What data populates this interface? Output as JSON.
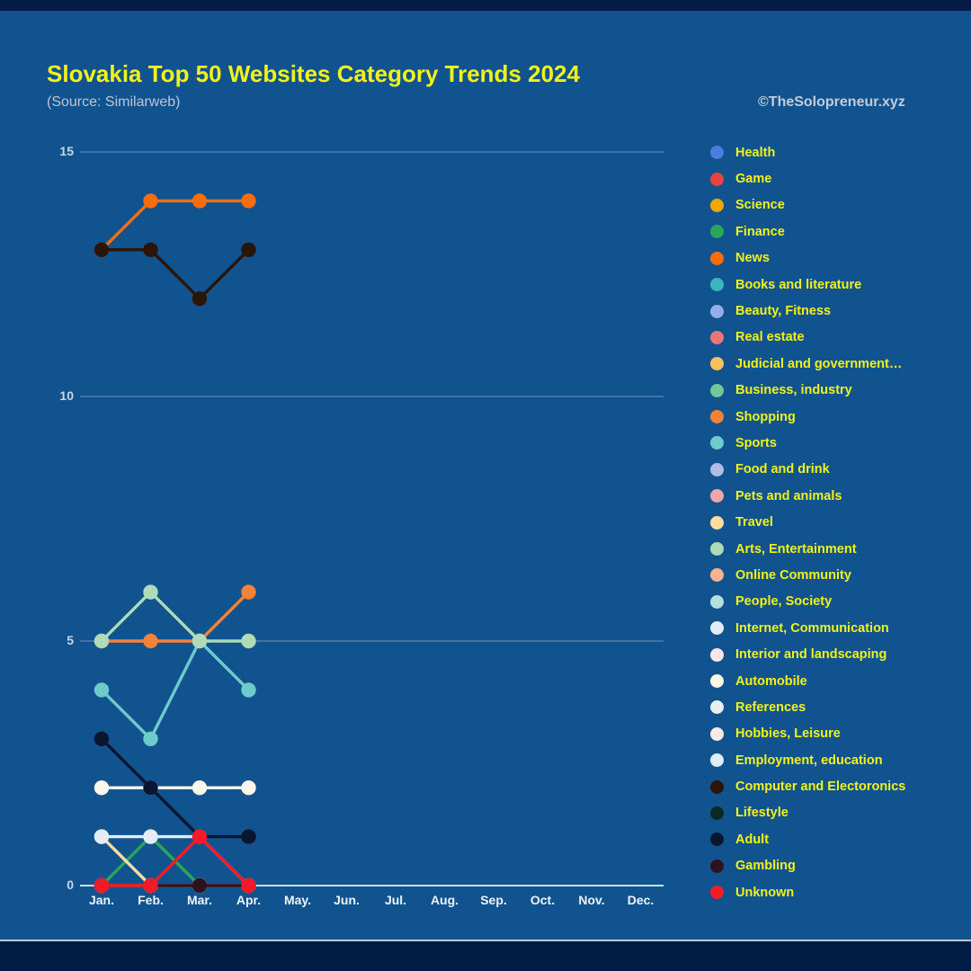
{
  "header": {
    "title": "Slovakia Top 50 Websites Category Trends 2024",
    "subtitle": "(Source: Similarweb)",
    "attribution": "©TheSolopreneur.xyz",
    "title_color": "#f2f21a",
    "background_color": "#10538f",
    "frame_color": "#031c45"
  },
  "chart_data": {
    "type": "line",
    "title": "Slovakia Top 50 Websites Category Trends 2024",
    "subtitle": "(Source: Similarweb)",
    "xlabel": "",
    "ylabel": "",
    "categories": [
      "Jan.",
      "Feb.",
      "Mar.",
      "Apr.",
      "May.",
      "Jun.",
      "Jul.",
      "Aug.",
      "Sep.",
      "Oct.",
      "Nov.",
      "Dec."
    ],
    "x_tick_labels": [
      "Jan.",
      "Feb.",
      "Mar.",
      "Apr.",
      "May.",
      "Jun.",
      "Jul.",
      "Aug.",
      "Sep.",
      "Oct.",
      "Nov.",
      "Dec."
    ],
    "y_tick_labels": [
      "0",
      "5",
      "10",
      "15"
    ],
    "y_ticks": [
      0,
      5,
      10,
      15
    ],
    "ylim": [
      0,
      16
    ],
    "grid": true,
    "grid_axis": "y",
    "legend_position": "right",
    "markers": true,
    "series": [
      {
        "name": "Health",
        "color": "#4a7ddc",
        "values": [
          0,
          0,
          0,
          0,
          null,
          null,
          null,
          null,
          null,
          null,
          null,
          null
        ]
      },
      {
        "name": "Game",
        "color": "#e8443f",
        "values": [
          0,
          0,
          0,
          0,
          null,
          null,
          null,
          null,
          null,
          null,
          null,
          null
        ]
      },
      {
        "name": "Science",
        "color": "#f0a800",
        "values": [
          0,
          0,
          0,
          0,
          null,
          null,
          null,
          null,
          null,
          null,
          null,
          null
        ]
      },
      {
        "name": "Finance",
        "color": "#2aa65a",
        "values": [
          0,
          1,
          0,
          0,
          null,
          null,
          null,
          null,
          null,
          null,
          null,
          null
        ]
      },
      {
        "name": "News",
        "color": "#f96e0b",
        "values": [
          13,
          14,
          14,
          14,
          null,
          null,
          null,
          null,
          null,
          null,
          null,
          null
        ]
      },
      {
        "name": "Books and literature",
        "color": "#38b6bd",
        "values": [
          0,
          0,
          0,
          0,
          null,
          null,
          null,
          null,
          null,
          null,
          null,
          null
        ]
      },
      {
        "name": "Beauty, Fitness",
        "color": "#93aee8",
        "values": [
          0,
          0,
          0,
          0,
          null,
          null,
          null,
          null,
          null,
          null,
          null,
          null
        ]
      },
      {
        "name": "Real estate",
        "color": "#e8777a",
        "values": [
          0,
          0,
          0,
          0,
          null,
          null,
          null,
          null,
          null,
          null,
          null,
          null
        ]
      },
      {
        "name": "Judicial and government…",
        "color": "#f8c160",
        "values": [
          0,
          0,
          0,
          0,
          null,
          null,
          null,
          null,
          null,
          null,
          null,
          null
        ]
      },
      {
        "name": "Business, industry",
        "color": "#72c79b",
        "values": [
          0,
          0,
          0,
          0,
          null,
          null,
          null,
          null,
          null,
          null,
          null,
          null
        ]
      },
      {
        "name": "Shopping",
        "color": "#f58337",
        "values": [
          5,
          5,
          5,
          6,
          null,
          null,
          null,
          null,
          null,
          null,
          null,
          null
        ]
      },
      {
        "name": "Sports",
        "color": "#6ecbcb",
        "values": [
          4,
          3,
          5,
          4,
          null,
          null,
          null,
          null,
          null,
          null,
          null,
          null
        ]
      },
      {
        "name": "Food and drink",
        "color": "#aebde8",
        "values": [
          0,
          0,
          0,
          0,
          null,
          null,
          null,
          null,
          null,
          null,
          null,
          null
        ]
      },
      {
        "name": "Pets and animals",
        "color": "#efa8a7",
        "values": [
          0,
          0,
          0,
          0,
          null,
          null,
          null,
          null,
          null,
          null,
          null,
          null
        ]
      },
      {
        "name": "Travel",
        "color": "#fbdda2",
        "values": [
          1,
          0,
          0,
          0,
          null,
          null,
          null,
          null,
          null,
          null,
          null,
          null
        ]
      },
      {
        "name": "Arts, Entertainment",
        "color": "#aedbb8",
        "values": [
          5,
          6,
          5,
          5,
          null,
          null,
          null,
          null,
          null,
          null,
          null,
          null
        ]
      },
      {
        "name": "Online Community",
        "color": "#f6b392",
        "values": [
          0,
          0,
          0,
          0,
          null,
          null,
          null,
          null,
          null,
          null,
          null,
          null
        ]
      },
      {
        "name": "People, Society",
        "color": "#b3e0de",
        "values": [
          0,
          0,
          0,
          0,
          null,
          null,
          null,
          null,
          null,
          null,
          null,
          null
        ]
      },
      {
        "name": "Internet, Communication",
        "color": "#e4ecf7",
        "values": [
          1,
          1,
          1,
          0,
          null,
          null,
          null,
          null,
          null,
          null,
          null,
          null
        ]
      },
      {
        "name": "Interior and landscaping",
        "color": "#fbe7e7",
        "values": [
          0,
          0,
          0,
          0,
          null,
          null,
          null,
          null,
          null,
          null,
          null,
          null
        ]
      },
      {
        "name": "Automobile",
        "color": "#fbf6ea",
        "values": [
          2,
          2,
          2,
          2,
          null,
          null,
          null,
          null,
          null,
          null,
          null,
          null
        ]
      },
      {
        "name": "References",
        "color": "#e6f0ee",
        "values": [
          0,
          0,
          0,
          0,
          null,
          null,
          null,
          null,
          null,
          null,
          null,
          null
        ]
      },
      {
        "name": "Hobbies, Leisure",
        "color": "#fbe9e4",
        "values": [
          0,
          0,
          0,
          0,
          null,
          null,
          null,
          null,
          null,
          null,
          null,
          null
        ]
      },
      {
        "name": "Employment, education",
        "color": "#ddeef6",
        "values": [
          0,
          0,
          0,
          0,
          null,
          null,
          null,
          null,
          null,
          null,
          null,
          null
        ]
      },
      {
        "name": "Computer and Electoronics",
        "color": "#2a1508",
        "values": [
          13,
          13,
          12,
          13,
          null,
          null,
          null,
          null,
          null,
          null,
          null,
          null
        ]
      },
      {
        "name": "Lifestyle",
        "color": "#0d2a20",
        "values": [
          0,
          0,
          0,
          0,
          null,
          null,
          null,
          null,
          null,
          null,
          null,
          null
        ]
      },
      {
        "name": "Adult",
        "color": "#0a1530",
        "values": [
          3,
          2,
          1,
          1,
          null,
          null,
          null,
          null,
          null,
          null,
          null,
          null
        ]
      },
      {
        "name": "Gambling",
        "color": "#2d1220",
        "values": [
          0,
          0,
          0,
          0,
          null,
          null,
          null,
          null,
          null,
          null,
          null,
          null
        ]
      },
      {
        "name": "Unknown",
        "color": "#f41a28",
        "values": [
          0,
          0,
          1,
          0,
          null,
          null,
          null,
          null,
          null,
          null,
          null,
          null
        ]
      }
    ]
  },
  "legend": {
    "items": [
      {
        "label": "Health",
        "color": "#4a7ddc"
      },
      {
        "label": "Game",
        "color": "#e8443f"
      },
      {
        "label": "Science",
        "color": "#f0a800"
      },
      {
        "label": "Finance",
        "color": "#2aa65a"
      },
      {
        "label": "News",
        "color": "#f96e0b"
      },
      {
        "label": "Books and literature",
        "color": "#38b6bd"
      },
      {
        "label": "Beauty, Fitness",
        "color": "#93aee8"
      },
      {
        "label": "Real estate",
        "color": "#e8777a"
      },
      {
        "label": "Judicial and government…",
        "color": "#f8c160"
      },
      {
        "label": "Business, industry",
        "color": "#72c79b"
      },
      {
        "label": "Shopping",
        "color": "#f58337"
      },
      {
        "label": "Sports",
        "color": "#6ecbcb"
      },
      {
        "label": "Food and drink",
        "color": "#aebde8"
      },
      {
        "label": "Pets and animals",
        "color": "#efa8a7"
      },
      {
        "label": "Travel",
        "color": "#fbdda2"
      },
      {
        "label": "Arts, Entertainment",
        "color": "#aedbb8"
      },
      {
        "label": "Online Community",
        "color": "#f6b392"
      },
      {
        "label": "People, Society",
        "color": "#b3e0de"
      },
      {
        "label": "Internet, Communication",
        "color": "#e4ecf7"
      },
      {
        "label": "Interior and landscaping",
        "color": "#fbe7e7"
      },
      {
        "label": "Automobile",
        "color": "#fbf6ea"
      },
      {
        "label": "References",
        "color": "#e6f0ee"
      },
      {
        "label": "Hobbies, Leisure",
        "color": "#fbe9e4"
      },
      {
        "label": "Employment, education",
        "color": "#ddeef6"
      },
      {
        "label": "Computer and Electoronics",
        "color": "#2a1508"
      },
      {
        "label": "Lifestyle",
        "color": "#0d2a20"
      },
      {
        "label": "Adult",
        "color": "#0a1530"
      },
      {
        "label": "Gambling",
        "color": "#2d1220"
      },
      {
        "label": "Unknown",
        "color": "#f41a28"
      }
    ]
  }
}
